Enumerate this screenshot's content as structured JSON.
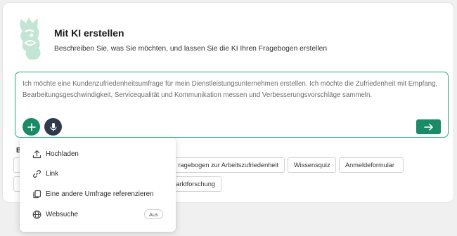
{
  "header": {
    "title": "Mit KI erstellen",
    "subtitle": "Beschreiben Sie, was Sie möchten, und lassen Sie die KI Ihren Fragebogen erstellen"
  },
  "prompt": {
    "text": "Ich möchte eine Kundenzufriedenheitsumfrage für mein Dienstleistungsunternehmen erstellen. Ich möchte die Zufriedenheit mit Empfang, Bearbeitungsgeschwindigkeit, Servicequalität und Kommunikation messen und Verbesserungsvorschläge sammeln."
  },
  "suggestions": {
    "label": "Be",
    "chips": [
      {
        "label": "ragebogen zur Arbeitszufriedenheit"
      },
      {
        "label": "Wissensquiz"
      },
      {
        "label": "Anmeldeformular"
      },
      {
        "label": "arktforschung"
      }
    ]
  },
  "menu": {
    "items": [
      {
        "label": "Hochladen",
        "icon": "upload-icon"
      },
      {
        "label": "Link",
        "icon": "link-icon"
      },
      {
        "label": "Eine andere Umfrage referenzieren",
        "icon": "copy-icon"
      },
      {
        "label": "Websuche",
        "icon": "globe-icon",
        "badge": "Aus"
      }
    ]
  },
  "colors": {
    "accent": "#1b8a66",
    "border_active": "#27a882",
    "mascot": "#c2e5d5",
    "mic_button": "#2f3b4c"
  }
}
